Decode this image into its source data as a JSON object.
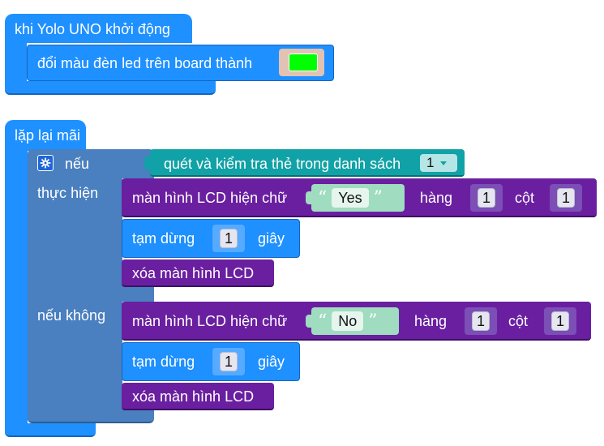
{
  "colors": {
    "event_blue": "#1e90ff",
    "control_steel": "#4a7fc0",
    "lcd_purple": "#6a1fa0",
    "sensor_teal": "#10a2a6",
    "led_color": "#00ff00",
    "string_green": "#9fdcc0"
  },
  "start_block": {
    "label": "khi Yolo UNO khởi động",
    "action_label": "đổi màu đèn led trên board thành",
    "led_color": "#00ff00"
  },
  "loop_block": {
    "label": "lặp lại mãi",
    "if_block": {
      "gear_icon": "gear-icon",
      "if_label": "nếu",
      "do_label": "thực hiện",
      "else_label": "nếu không",
      "condition": {
        "label": "quét và kiểm tra thẻ trong danh sách",
        "dropdown_value": "1",
        "dropdown_icon": "triangle-down-icon"
      },
      "then": {
        "lcd_label": "màn hình LCD hiện chữ",
        "text": "Yes",
        "row_label": "hàng",
        "row": "1",
        "col_label": "cột",
        "col": "1",
        "pause_label": "tạm dừng",
        "pause_value": "1",
        "pause_unit": "giây",
        "clear_label": "xóa màn hình LCD"
      },
      "else": {
        "lcd_label": "màn hình LCD hiện chữ",
        "text": "No",
        "row_label": "hàng",
        "row": "1",
        "col_label": "cột",
        "col": "1",
        "pause_label": "tạm dừng",
        "pause_value": "1",
        "pause_unit": "giây",
        "clear_label": "xóa màn hình LCD"
      }
    }
  }
}
